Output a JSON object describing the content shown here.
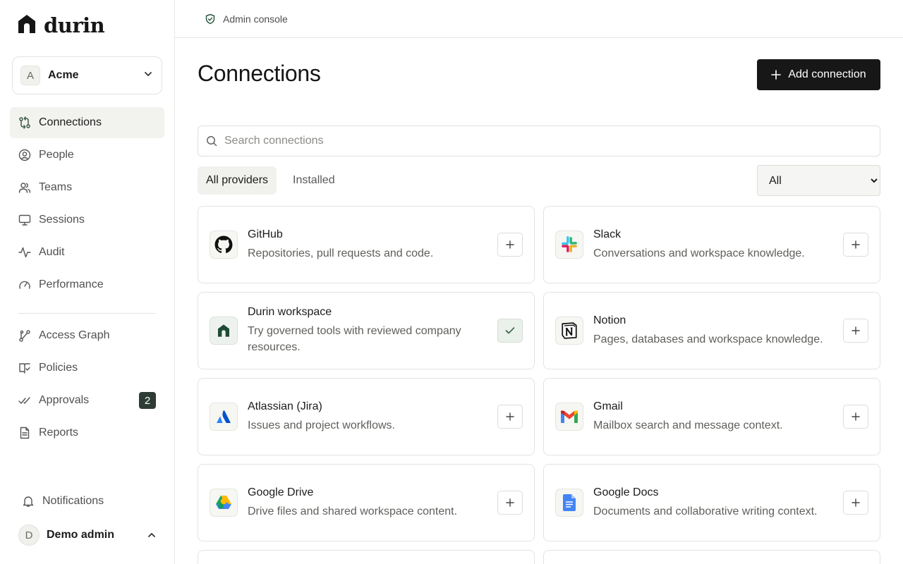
{
  "brand": {
    "name": "durin"
  },
  "org": {
    "name": "Acme",
    "initial": "A"
  },
  "nav": {
    "primary": [
      {
        "label": "Connections"
      },
      {
        "label": "People"
      },
      {
        "label": "Teams"
      },
      {
        "label": "Sessions"
      },
      {
        "label": "Audit"
      },
      {
        "label": "Performance"
      }
    ],
    "secondary": [
      {
        "label": "Access Graph"
      },
      {
        "label": "Policies"
      },
      {
        "label": "Approvals",
        "badge": "2"
      },
      {
        "label": "Reports"
      }
    ],
    "active": "Connections"
  },
  "footer": {
    "notifications": "Notifications",
    "user": {
      "name": "Demo admin",
      "initial": "D"
    }
  },
  "topbar": {
    "breadcrumb": "Admin console",
    "icon": "shield-check-icon"
  },
  "main": {
    "title": "Connections",
    "add_button": "Add connection",
    "search": {
      "placeholder": "Search connections",
      "value": ""
    },
    "tabs": [
      {
        "label": "All providers",
        "active": true
      },
      {
        "label": "Installed",
        "active": false
      }
    ],
    "filter": {
      "selected": "All"
    }
  },
  "providers": [
    {
      "name": "GitHub",
      "desc": "Repositories, pull requests and code.",
      "icon": "github-icon",
      "installed": false
    },
    {
      "name": "Slack",
      "desc": "Conversations and workspace knowledge.",
      "icon": "slack-icon",
      "installed": false
    },
    {
      "name": "Durin workspace",
      "desc": "Try governed tools with reviewed company resources.",
      "icon": "durin-icon",
      "installed": true
    },
    {
      "name": "Notion",
      "desc": "Pages, databases and workspace knowledge.",
      "icon": "notion-icon",
      "installed": false
    },
    {
      "name": "Atlassian (Jira)",
      "desc": "Issues and project workflows.",
      "icon": "atlassian-icon",
      "installed": false
    },
    {
      "name": "Gmail",
      "desc": "Mailbox search and message context.",
      "icon": "gmail-icon",
      "installed": false
    },
    {
      "name": "Google Drive",
      "desc": "Drive files and shared workspace content.",
      "icon": "google-drive-icon",
      "installed": false
    },
    {
      "name": "Google Docs",
      "desc": "Documents and collaborative writing context.",
      "icon": "google-docs-icon",
      "installed": false
    }
  ],
  "colors": {
    "primary_button": "#171717",
    "active_nav_bg": "#f2f3ef",
    "badge_bg": "#2f3b35",
    "installed_bg": "#eaf0ea"
  }
}
